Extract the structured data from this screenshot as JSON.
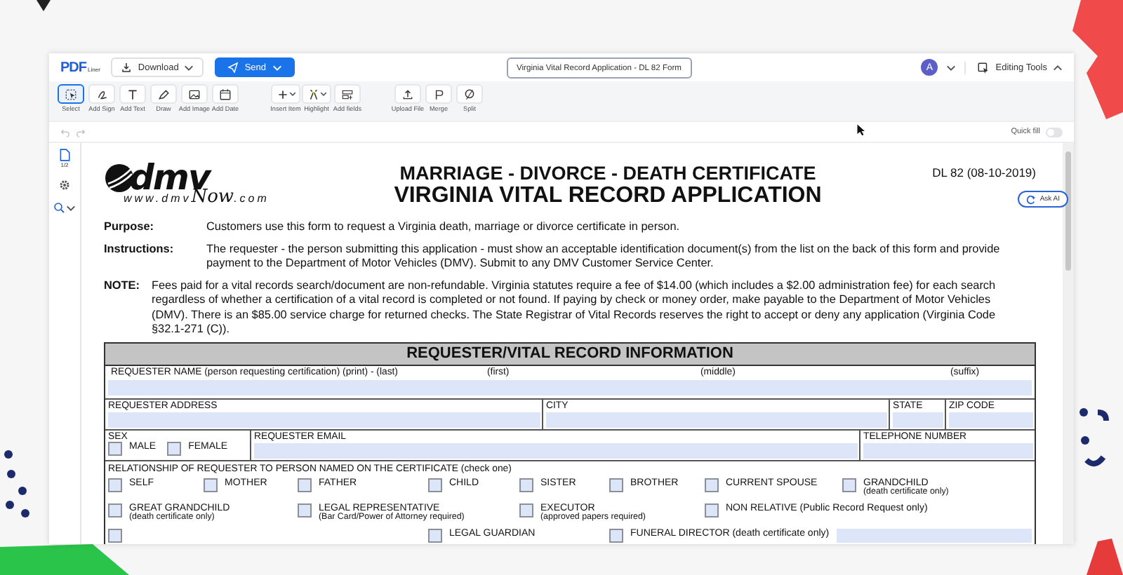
{
  "app": {
    "logo": "PDF",
    "logo_sub": "Liner",
    "download": "Download",
    "send": "Send",
    "document_title": "Virginia Vital Record Application - DL 82 Form",
    "avatar": "A",
    "editing_tools": "Editing Tools"
  },
  "toolbar": [
    [
      {
        "kind": "select",
        "label": "Select",
        "selected": true,
        "dropdown": false
      },
      {
        "kind": "sign",
        "label": "Add Sign",
        "selected": false,
        "dropdown": false
      },
      {
        "kind": "text",
        "label": "Add Text",
        "selected": false,
        "dropdown": false
      },
      {
        "kind": "draw",
        "label": "Draw",
        "selected": false,
        "dropdown": false
      },
      {
        "kind": "image",
        "label": "Add Image",
        "selected": false,
        "dropdown": false
      },
      {
        "kind": "date",
        "label": "Add Date",
        "selected": false,
        "dropdown": false
      }
    ],
    [
      {
        "kind": "insert",
        "label": "Insert Item",
        "selected": false,
        "dropdown": true
      },
      {
        "kind": "highlight",
        "label": "Highlight",
        "selected": false,
        "dropdown": true
      },
      {
        "kind": "fields",
        "label": "Add fields",
        "selected": false,
        "dropdown": false
      }
    ],
    [
      {
        "kind": "upload",
        "label": "Upload File",
        "selected": false,
        "dropdown": false
      },
      {
        "kind": "merge",
        "label": "Merge",
        "selected": false,
        "dropdown": false
      },
      {
        "kind": "split",
        "label": "Split",
        "selected": false,
        "dropdown": false
      }
    ]
  ],
  "quick_fill": {
    "label": "Quick fill",
    "on": false
  },
  "sidebar": {
    "page_count": "1/2"
  },
  "ask_ai": "Ask AI",
  "document": {
    "logo_mark": "dmv",
    "logo_url": "www.dmv",
    "logo_now": "Now",
    "logo_com": ".com",
    "title": "MARRIAGE - DIVORCE - DEATH CERTIFICATE",
    "subtitle": "VIRGINIA VITAL RECORD APPLICATION",
    "form_number": "DL 82 (08-10-2019)",
    "paragraphs": [
      {
        "kind": "field",
        "label": "Purpose:",
        "text": "Customers use this form to request a Virginia death, marriage or divorce certificate in person."
      },
      {
        "kind": "field",
        "label": "Instructions:",
        "text": "The requester - the person submitting this application - must show an acceptable identification document(s) from the list on the back of this form and provide payment to the Department of Motor Vehicles (DMV).  Submit to any DMV Customer Service Center."
      },
      {
        "kind": "note",
        "label": "NOTE:",
        "text": "Fees paid for a vital records search/document are non-refundable.  Virginia statutes require a fee of $14.00 (which includes a $2.00 administration fee) for each search regardless of whether a certification of a vital record is completed or not found. If paying by check or money order, make payable to the Department of Motor Vehicles (DMV). There is an $85.00 service charge for returned checks. The State Registrar of Vital Records reserves the right to accept or deny any application (Virginia Code §32.1-271 (C))."
      }
    ],
    "section_header": "REQUESTER/VITAL RECORD INFORMATION",
    "name_labels": [
      "REQUESTER NAME (person requesting certification) (print) - (last)",
      "(first)",
      "(middle)",
      "(suffix)"
    ],
    "address_labels": [
      "REQUESTER ADDRESS",
      "CITY",
      "STATE",
      "ZIP CODE"
    ],
    "sex": {
      "label": "SEX",
      "options": [
        {
          "label": "MALE",
          "checked": false
        },
        {
          "label": "FEMALE",
          "checked": false
        }
      ]
    },
    "email_label": "REQUESTER EMAIL",
    "phone_label": "TELEPHONE NUMBER",
    "relationship_label": "RELATIONSHIP OF REQUESTER TO PERSON NAMED ON THE CERTIFICATE (check one)",
    "relationships": [
      [
        {
          "label": "SELF",
          "checked": false
        },
        {
          "label": "MOTHER",
          "checked": false
        },
        {
          "label": "FATHER",
          "checked": false
        },
        {
          "label": "CHILD",
          "checked": false
        },
        {
          "label": "SISTER",
          "checked": false
        },
        {
          "label": "BROTHER",
          "checked": false
        },
        {
          "label": "CURRENT SPOUSE",
          "checked": false
        },
        {
          "label": "GRANDCHILD",
          "note": "(death certificate only)",
          "checked": false
        }
      ],
      [
        {
          "label": "GREAT GRANDCHILD",
          "note": "(death certificate only)",
          "checked": false
        },
        {
          "label": "LEGAL REPRESENTATIVE",
          "note": "(Bar Card/Power of Attorney required)",
          "checked": false
        },
        {
          "label": "EXECUTOR",
          "note": "(approved papers required)",
          "checked": false
        },
        {
          "label": "NON RELATIVE (Public Record Request only)",
          "checked": false
        }
      ],
      [
        {
          "checked": false
        },
        {
          "label": "LEGAL GUARDIAN",
          "checked": false
        },
        {
          "label": "FUNERAL DIRECTOR (death certificate only)",
          "checked": false,
          "field": true
        }
      ]
    ]
  }
}
